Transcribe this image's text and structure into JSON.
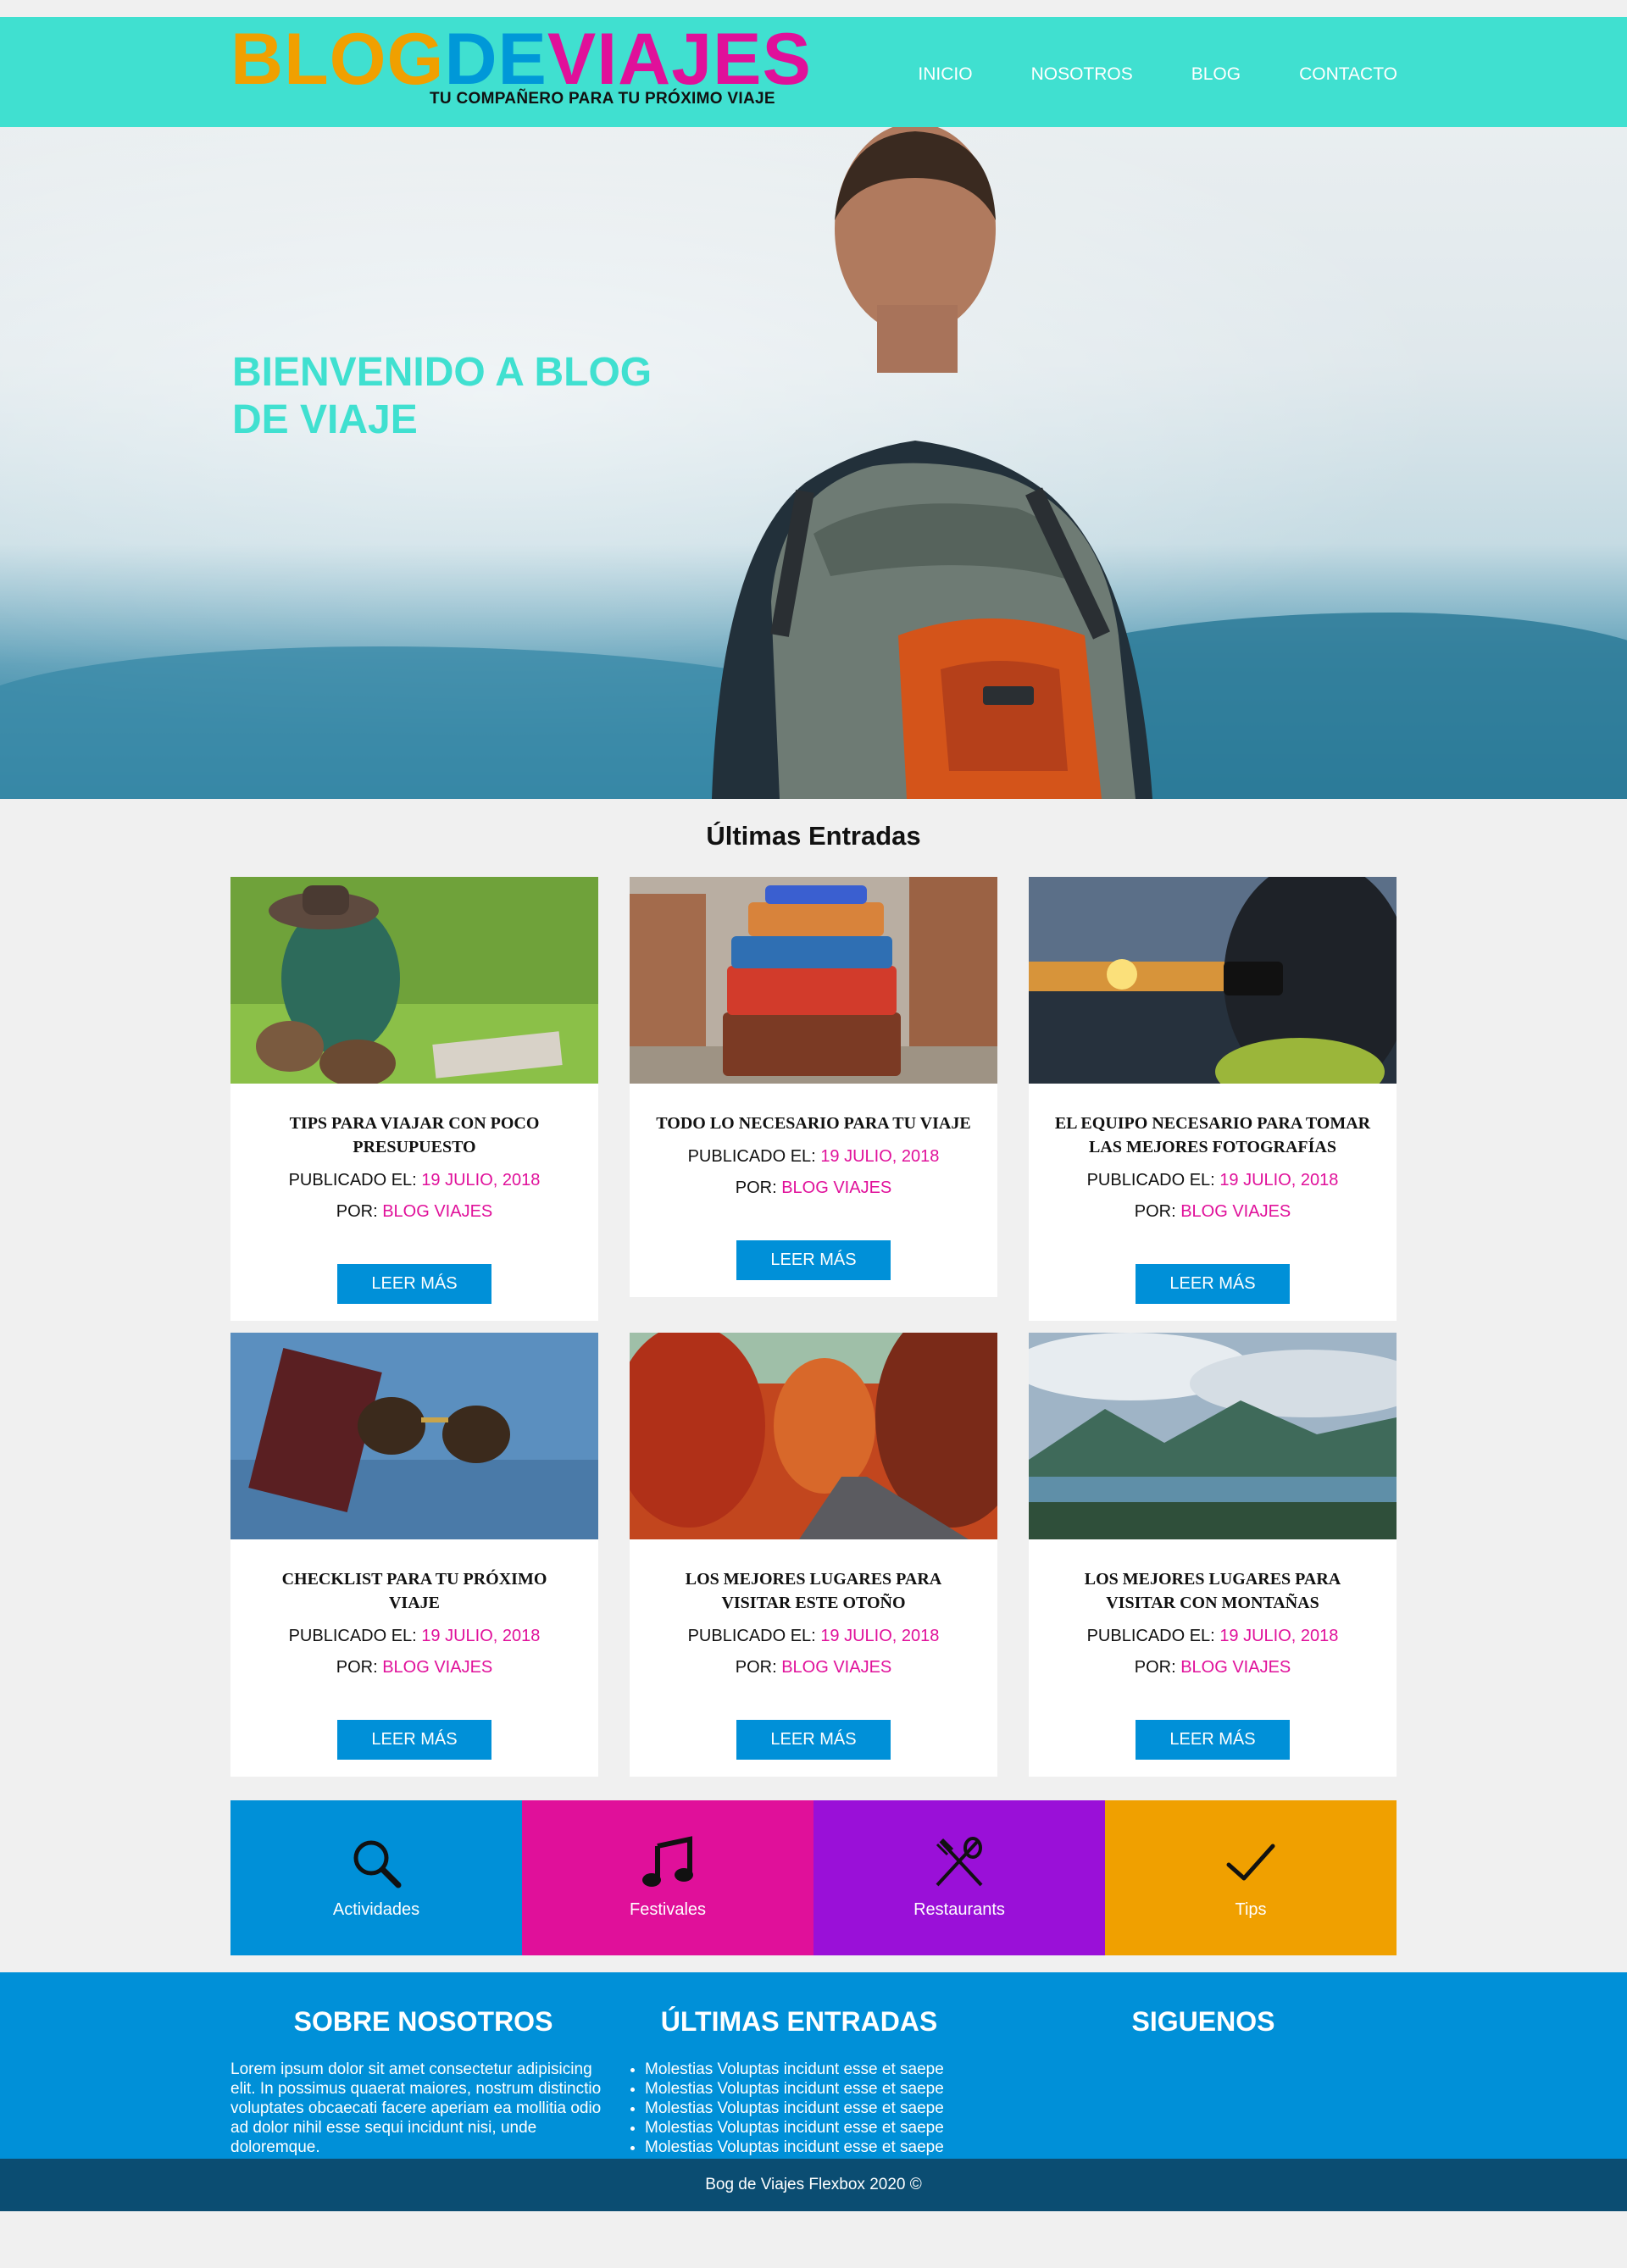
{
  "header": {
    "logo": {
      "part1": "BLOG",
      "part2": "DE",
      "part3": "VIAJES",
      "tagline": "TU COMPAÑERO PARA TU PRÓXIMO VIAJE"
    },
    "nav": [
      "INICIO",
      "NOSOTROS",
      "BLOG",
      "CONTACTO"
    ]
  },
  "hero": {
    "title": "BIENVENIDO A BLOG DE VIAJE"
  },
  "entries": {
    "title": "Últimas Entradas",
    "published_label": "PUBLICADO EL:",
    "by_label": "POR:",
    "button_label": "LEER MÁS",
    "posts": [
      {
        "title": "TIPS PARA VIAJAR CON POCO PRESUPUESTO",
        "date": "19 JULIO, 2018",
        "author": "BLOG VIAJES"
      },
      {
        "title": "TODO LO NECESARIO PARA TU VIAJE",
        "date": "19 JULIO, 2018",
        "author": "BLOG VIAJES"
      },
      {
        "title": "EL EQUIPO NECESARIO PARA TOMAR LAS MEJORES FOTOGRAFÍAS",
        "date": "19 JULIO, 2018",
        "author": "BLOG VIAJES"
      },
      {
        "title": "CHECKLIST PARA TU PRÓXIMO VIAJE",
        "date": "19 JULIO, 2018",
        "author": "BLOG VIAJES"
      },
      {
        "title": "LOS MEJORES LUGARES PARA VISITAR ESTE OTOÑO",
        "date": "19 JULIO, 2018",
        "author": "BLOG VIAJES"
      },
      {
        "title": "LOS MEJORES LUGARES PARA VISITAR CON MONTAÑAS",
        "date": "19 JULIO, 2018",
        "author": "BLOG VIAJES"
      }
    ]
  },
  "categories": [
    {
      "label": "Actividades",
      "icon": "search-icon",
      "color": "#0090d8"
    },
    {
      "label": "Festivales",
      "icon": "music-icon",
      "color": "#e0109a"
    },
    {
      "label": "Restaurants",
      "icon": "utensils-icon",
      "color": "#9a10d8"
    },
    {
      "label": "Tips",
      "icon": "check-icon",
      "color": "#f0a000"
    }
  ],
  "footer": {
    "about": {
      "title": "SOBRE NOSOTROS",
      "text": "Lorem ipsum dolor sit amet consectetur adipisicing elit. In possimus quaerat maiores, nostrum distinctio voluptates obcaecati facere aperiam ea mollitia odio ad dolor nihil esse sequi incidunt nisi, unde doloremque."
    },
    "latest": {
      "title": "ÚLTIMAS ENTRADAS",
      "items": [
        "Molestias Voluptas incidunt esse et saepe",
        "Molestias Voluptas incidunt esse et saepe",
        "Molestias Voluptas incidunt esse et saepe",
        "Molestias Voluptas incidunt esse et saepe",
        "Molestias Voluptas incidunt esse et saepe"
      ]
    },
    "social": {
      "title": "SIGUENOS"
    },
    "copyright": "Bog de Viajes Flexbox 2020 ©"
  },
  "colors": {
    "turquoise": "#40e0d0",
    "blue": "#0090d8",
    "pink": "#e0109a",
    "purple": "#9a10d8",
    "orange": "#f0a000",
    "dark_blue": "#0b4d72"
  }
}
